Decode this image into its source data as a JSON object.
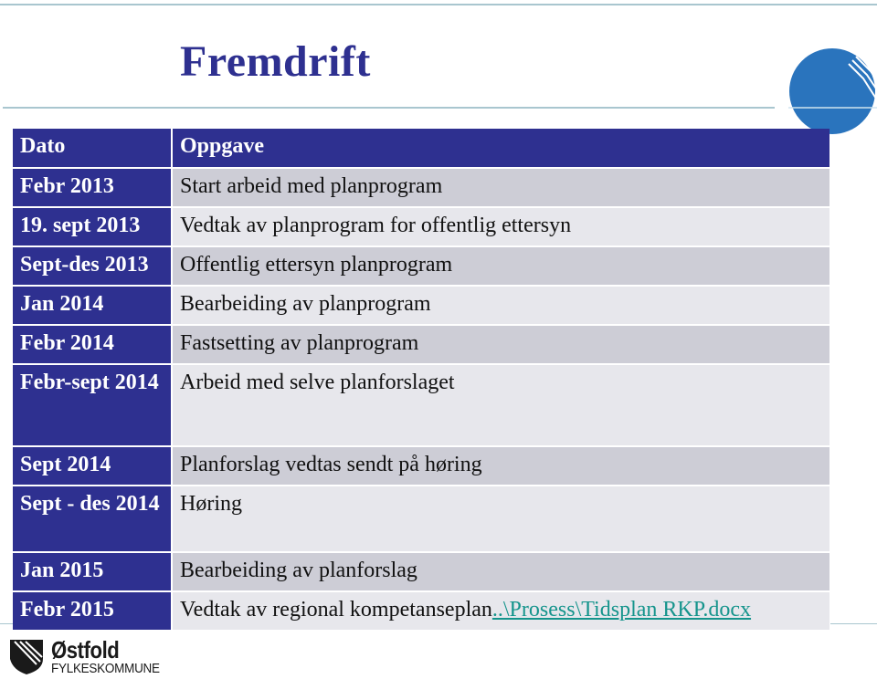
{
  "slide": {
    "title": "Fremdrift"
  },
  "table": {
    "headers": {
      "dato": "Dato",
      "oppgave": "Oppgave"
    },
    "rows": [
      {
        "dato": "Febr 2013",
        "oppgave": "Start arbeid med planprogram"
      },
      {
        "dato": "19. sept 2013",
        "oppgave": "Vedtak av planprogram for offentlig ettersyn"
      },
      {
        "dato": "Sept-des 2013",
        "oppgave": "Offentlig ettersyn planprogram"
      },
      {
        "dato": "Jan 2014",
        "oppgave": "Bearbeiding av planprogram"
      },
      {
        "dato": "Febr 2014",
        "oppgave": "Fastsetting av planprogram"
      },
      {
        "dato": "Febr-sept 2014",
        "oppgave": "Arbeid med selve planforslaget"
      },
      {
        "dato": "Sept 2014",
        "oppgave": "Planforslag vedtas sendt på høring"
      },
      {
        "dato": "Sept - des 2014",
        "oppgave": "Høring"
      },
      {
        "dato": "Jan 2015",
        "oppgave": "Bearbeiding av planforslag"
      },
      {
        "dato": "Febr 2015",
        "oppgave": "Vedtak av regional kompetanseplan",
        "link": "..\\Prosess\\Tidsplan RKP.docx"
      }
    ]
  },
  "logo": {
    "name": "Østfold",
    "subtitle": "FYLKESKOMMUNE"
  },
  "colors": {
    "header_bg": "#2e3090",
    "row_odd": "#cdcdd6",
    "row_even": "#e7e7ec",
    "link": "#15948c",
    "globe": "#2a74bd"
  }
}
